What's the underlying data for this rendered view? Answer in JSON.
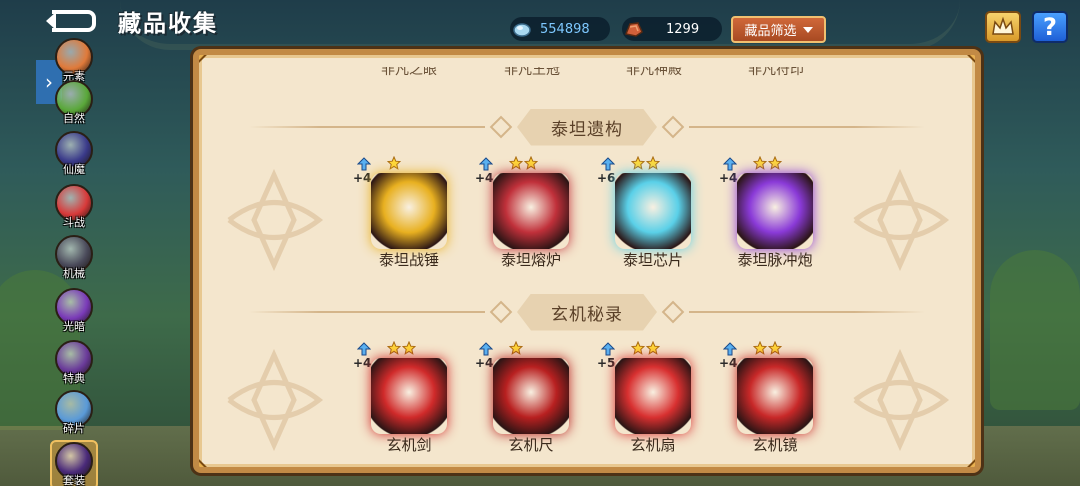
{
  "header": {
    "title": "藏品收集",
    "back_icon": "back-arrow-icon"
  },
  "currencies": [
    {
      "icon": "gem-icon",
      "value": "554898",
      "color": "#7ec8ff"
    },
    {
      "icon": "ore-icon",
      "value": "1299",
      "color": "#ffffff"
    }
  ],
  "filter_label": "藏品筛选",
  "crown_icon": "crown-icon",
  "help_label": "?",
  "sidebar": {
    "expand_glyph": "›",
    "items": [
      {
        "label": "元素",
        "icon": "element-icon",
        "color": "#e07a3a"
      },
      {
        "label": "自然",
        "icon": "nature-icon",
        "color": "#5aa83a"
      },
      {
        "label": "仙魔",
        "icon": "demon-icon",
        "color": "#3a3a8a"
      },
      {
        "label": "斗战",
        "icon": "battle-icon",
        "color": "#d83a3a"
      },
      {
        "label": "机械",
        "icon": "mech-icon",
        "color": "#4a4a5a"
      },
      {
        "label": "光暗",
        "icon": "light-dark-icon",
        "color": "#7a3ab8"
      },
      {
        "label": "特典",
        "icon": "special-icon",
        "color": "#6a3a9a"
      },
      {
        "label": "碎片",
        "icon": "shard-icon",
        "color": "#5a9ad8"
      },
      {
        "label": "套装",
        "icon": "set-icon",
        "color": "#4a2a7a"
      }
    ]
  },
  "panel": {
    "top_labels": [
      "非凡之眼",
      "非凡王冠",
      "非凡神殿",
      "非凡符印"
    ],
    "sections": [
      {
        "title": "泰坦遗构",
        "items": [
          {
            "name": "泰坦战锤",
            "level": "+4",
            "stars": 1,
            "color": "#e8b020",
            "icon": "titan-hammer-icon"
          },
          {
            "name": "泰坦熔炉",
            "level": "+4",
            "stars": 2,
            "color": "#c0303a",
            "icon": "titan-furnace-icon"
          },
          {
            "name": "泰坦芯片",
            "level": "+6",
            "stars": 2,
            "color": "#5ad0e8",
            "icon": "titan-chip-icon"
          },
          {
            "name": "泰坦脉冲炮",
            "level": "+4",
            "stars": 2,
            "color": "#8a3ad8",
            "icon": "titan-pulse-cannon-icon"
          }
        ]
      },
      {
        "title": "玄机秘录",
        "items": [
          {
            "name": "玄机剑",
            "level": "+4",
            "stars": 2,
            "color": "#d02a2a",
            "icon": "mystic-sword-icon"
          },
          {
            "name": "玄机尺",
            "level": "+4",
            "stars": 1,
            "color": "#b82020",
            "icon": "mystic-ruler-icon"
          },
          {
            "name": "玄机扇",
            "level": "+5",
            "stars": 2,
            "color": "#d83030",
            "icon": "mystic-fan-icon"
          },
          {
            "name": "玄机镜",
            "level": "+4",
            "stars": 2,
            "color": "#c82828",
            "icon": "mystic-mirror-icon"
          }
        ]
      }
    ]
  }
}
